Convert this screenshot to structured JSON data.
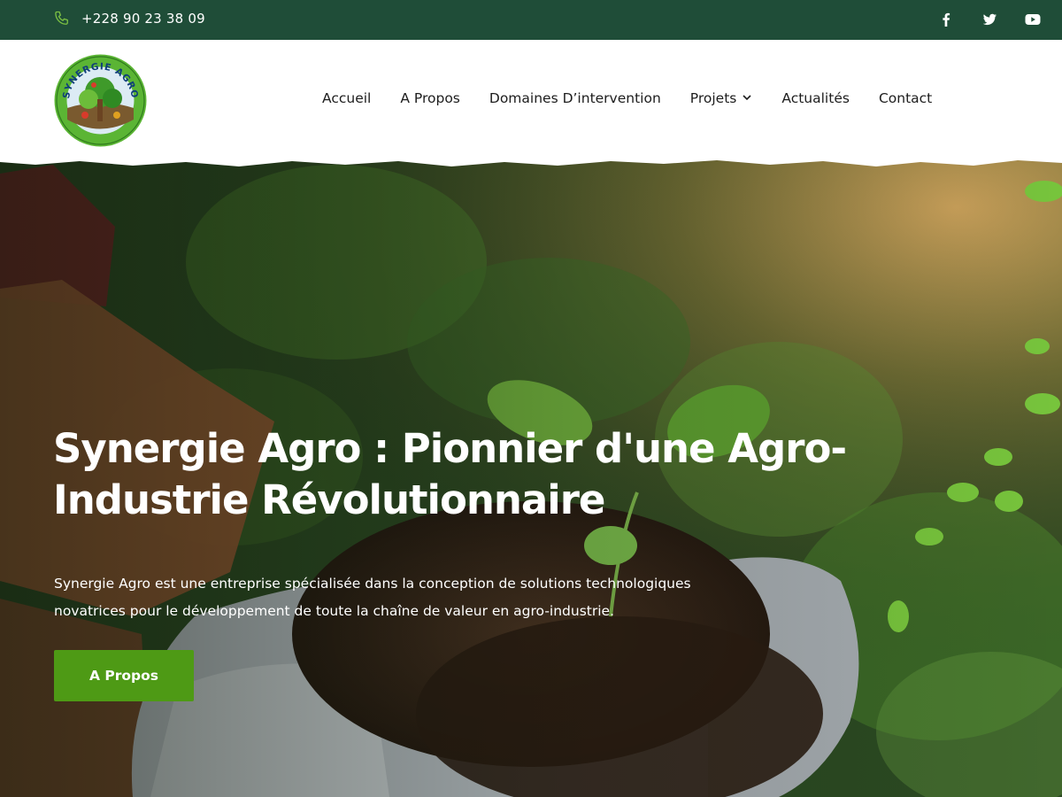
{
  "topbar": {
    "phone": "+228 90 23 38 09",
    "phone_icon": "phone-icon",
    "socials": [
      "facebook-icon",
      "twitter-icon",
      "youtube-icon"
    ]
  },
  "header": {
    "logo_text": "SYNERGIE AGRO",
    "nav": [
      {
        "label": "Accueil"
      },
      {
        "label": "A Propos"
      },
      {
        "label": "Domaines D’intervention"
      },
      {
        "label": "Projets",
        "has_dropdown": true
      },
      {
        "label": "Actualités"
      },
      {
        "label": "Contact"
      }
    ]
  },
  "hero": {
    "title_line1": "Synergie Agro : Pionnier d'une Agro-",
    "title_line2": "Industrie Révolutionnaire",
    "desc_line1": "Synergie Agro est une entreprise spécialisée dans la conception de solutions technologiques",
    "desc_line2": "novatrices pour le développement de toute la chaîne de valeur en agro-industrie.",
    "button": "A Propos"
  },
  "colors": {
    "topbar_bg": "#1f4d38",
    "button_bg": "#4e9a15",
    "phone_icon": "#7bc043"
  }
}
